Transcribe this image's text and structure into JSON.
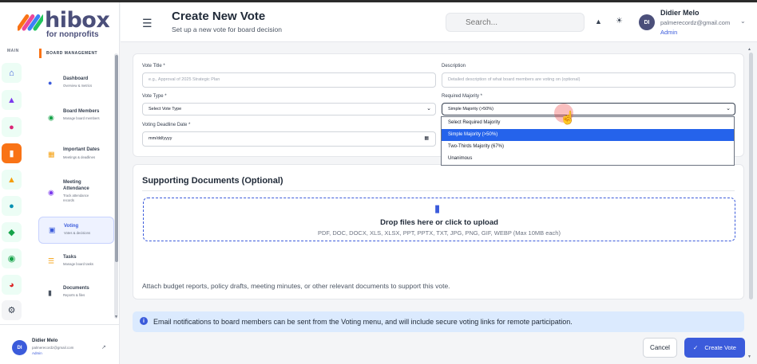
{
  "brand": {
    "name": "hibox",
    "tagline": "for nonprofits"
  },
  "sidebar": {
    "rail_label": "MAIN",
    "rail_icons": [
      "home-icon",
      "org-chart-icon",
      "palette-icon",
      "document-icon",
      "cap-icon",
      "circle-icon",
      "network-icon",
      "people-icon",
      "pie-chart-icon",
      "gear-icon"
    ],
    "section_label": "BOARD MANAGEMENT",
    "items": [
      {
        "title": "Dashboard",
        "sub": "Overview & metrics",
        "icon": "dashboard-icon"
      },
      {
        "title": "Board Members",
        "sub": "Manage board members",
        "icon": "members-icon"
      },
      {
        "title": "Important Dates",
        "sub": "Meetings & deadlines",
        "icon": "calendar-icon"
      },
      {
        "title": "Meeting Attendance",
        "sub": "Track attendance records",
        "icon": "attendance-icon"
      },
      {
        "title": "Voting",
        "sub": "Votes & decisions",
        "icon": "voting-icon"
      },
      {
        "title": "Tasks",
        "sub": "Manage board tasks",
        "icon": "tasks-icon"
      },
      {
        "title": "Documents",
        "sub": "Reports & files",
        "icon": "documents-icon"
      }
    ],
    "user": {
      "initials": "DI",
      "name": "Didier Melo",
      "email": "palmerecordz@gmail.com",
      "role": "Admin"
    }
  },
  "header": {
    "title": "Create New Vote",
    "subtitle": "Set up a new vote for board decision",
    "search_placeholder": "Search...",
    "user": {
      "initials": "DI",
      "name": "Didier Melo",
      "email": "palmerecordz@gmail.com",
      "role": "Admin"
    }
  },
  "form": {
    "vote_title_label": "Vote Title *",
    "vote_title_placeholder": "e.g., Approval of 2025 Strategic Plan",
    "description_label": "Description",
    "description_placeholder": "Detailed description of what board members are voting on (optional)",
    "vote_type_label": "Vote Type *",
    "vote_type_value": "Select Vote Type",
    "required_majority_label": "Required Majority *",
    "required_majority_value": "Simple Majority (>50%)",
    "deadline_label": "Voting Deadline Date *",
    "deadline_value": "mm/dd/yyyy",
    "majority_options": [
      "Select Required Majority",
      "Simple Majority (>50%)",
      "Two-Thirds Majority (67%)",
      "Unanimous"
    ],
    "highlighted_option_index": 1
  },
  "documents": {
    "title": "Supporting Documents (Optional)",
    "drop_title": "Drop files here or click to upload",
    "drop_types": "PDF, DOC, DOCX, XLS, XLSX, PPT, PPTX, TXT, JPG, PNG, GIF, WEBP (Max 10MB each)",
    "hint": "Attach budget reports, policy drafts, meeting minutes, or other relevant documents to support this vote."
  },
  "info_message": "Email notifications to board members can be sent from the Voting menu, and will include secure voting links for remote participation.",
  "actions": {
    "cancel": "Cancel",
    "create": "Create Vote"
  },
  "colors": {
    "accent": "#3b5bdb",
    "brand_orange": "#f97316",
    "highlight": "#2563eb",
    "info_bg": "#dbeafe"
  }
}
